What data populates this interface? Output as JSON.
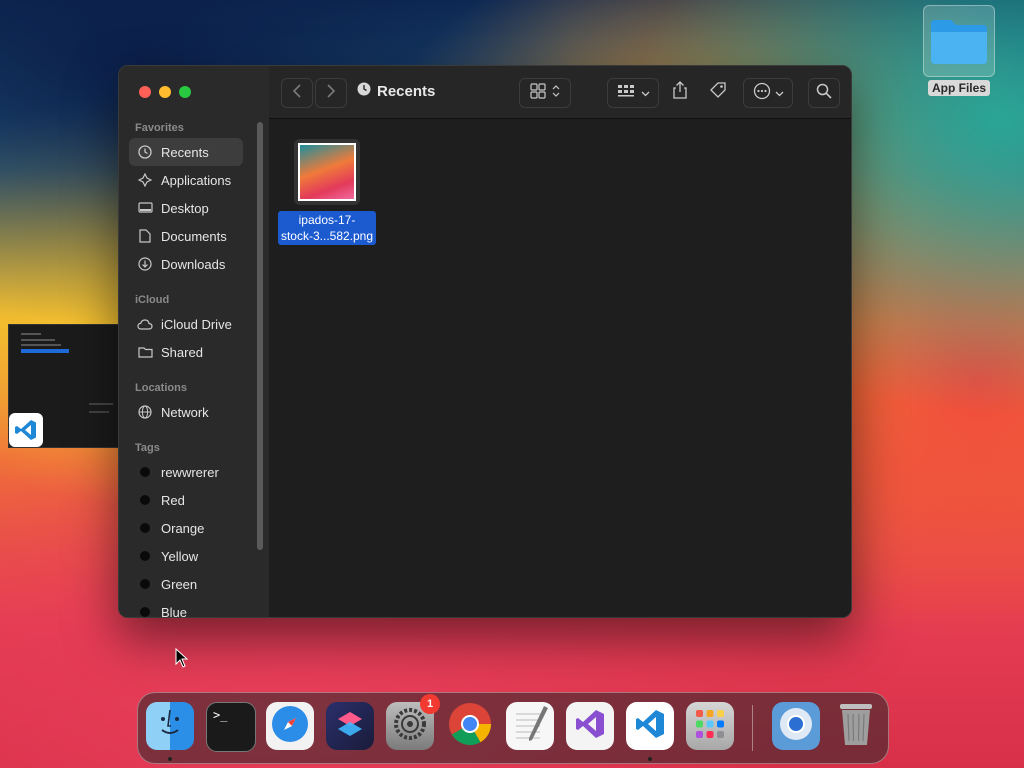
{
  "desktop": {
    "folder_label": "App Files"
  },
  "finder": {
    "title": "Recents",
    "sidebar": {
      "favorites_title": "Favorites",
      "favorites": [
        {
          "label": "Recents",
          "icon": "clock-icon"
        },
        {
          "label": "Applications",
          "icon": "applications-icon"
        },
        {
          "label": "Desktop",
          "icon": "desktop-icon"
        },
        {
          "label": "Documents",
          "icon": "document-icon"
        },
        {
          "label": "Downloads",
          "icon": "download-icon"
        }
      ],
      "icloud_title": "iCloud",
      "icloud": [
        {
          "label": "iCloud Drive",
          "icon": "cloud-icon"
        },
        {
          "label": "Shared",
          "icon": "shared-folder-icon"
        }
      ],
      "locations_title": "Locations",
      "locations": [
        {
          "label": "Network",
          "icon": "globe-icon"
        }
      ],
      "tags_title": "Tags",
      "tags": [
        {
          "label": "rewwrerer"
        },
        {
          "label": "Red"
        },
        {
          "label": "Orange"
        },
        {
          "label": "Yellow"
        },
        {
          "label": "Green"
        },
        {
          "label": "Blue"
        }
      ]
    },
    "files": [
      {
        "name_line1": "ipados-17-",
        "name_line2": "stock-3...582.png"
      }
    ]
  },
  "dock": {
    "apps": [
      "Finder",
      "Terminal",
      "Safari",
      "Shortcuts",
      "System Settings",
      "Chrome",
      "TextEdit",
      "Visual Studio",
      "VS Code",
      "Launchpad",
      "Chromium",
      "Trash"
    ],
    "settings_badge": "1"
  },
  "colors": {
    "accent": "#1c5ad0",
    "window_bg": "#1e1e1e",
    "sidebar_bg": "#2a2a2a"
  }
}
